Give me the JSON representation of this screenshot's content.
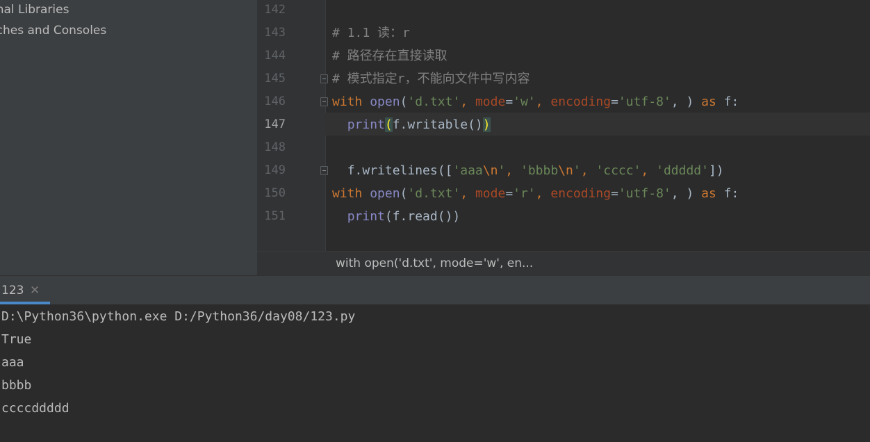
{
  "sidebar": {
    "items": [
      {
        "label": "rnal Libraries"
      },
      {
        "label": "tches and Consoles"
      }
    ]
  },
  "editor": {
    "line_numbers": [
      "142",
      "143",
      "144",
      "145",
      "146",
      "147",
      "148",
      "149",
      "150",
      "151"
    ],
    "current_line": "147",
    "lines": {
      "l143": "# 1.1 读：r",
      "l144": "# 路径存在直接读取",
      "l145": "# 模式指定r，不能向文件中写内容",
      "l146": {
        "kw_with": "with",
        "fn_open": "open",
        "p1": "(",
        "s1": "'d.txt'",
        "p2": ", ",
        "k1": "mode",
        "p3": "=",
        "s2": "'w'",
        "p4": ", ",
        "k2": "encoding",
        "p5": "=",
        "s3": "'utf-8'",
        "p6": ", ) ",
        "kw_as": "as",
        "p7": " f:"
      },
      "l147": {
        "fn_print": "print",
        "brace_open": "(",
        "mid": "f.writable()",
        "brace_close": ")"
      },
      "l149": {
        "p1": "f.writelines([",
        "s1a": "'aaa",
        "e1": "\\n",
        "s1b": "'",
        "p2": ", ",
        "s2a": "'bbbb",
        "e2": "\\n",
        "s2b": "'",
        "p3": ", ",
        "s3": "'cccc'",
        "p4": ", ",
        "s4": "'ddddd'",
        "p5": "])"
      },
      "l150": {
        "kw_with": "with",
        "fn_open": "open",
        "p1": "(",
        "s1": "'d.txt'",
        "p2": ", ",
        "k1": "mode",
        "p3": "=",
        "s2": "'r'",
        "p4": ", ",
        "k2": "encoding",
        "p5": "=",
        "s3": "'utf-8'",
        "p6": ", ) ",
        "kw_as": "as",
        "p7": " f:"
      },
      "l151": {
        "fn_print": "print",
        "rest": "(f.read())"
      }
    }
  },
  "breadcrumb": {
    "text": "with open('d.txt', mode='w', en..."
  },
  "run": {
    "tab_label": "123",
    "close_glyph": "✕",
    "console": [
      "D:\\Python36\\python.exe D:/Python36/day08/123.py",
      "True",
      "aaa",
      "bbbb",
      "ccccddddd"
    ]
  },
  "colors": {
    "keyword": "#cc7832",
    "builtin": "#8888c6",
    "string": "#6a8759",
    "kwarg": "#aa4926",
    "comment": "#808080",
    "accent": "#4a88c7"
  }
}
